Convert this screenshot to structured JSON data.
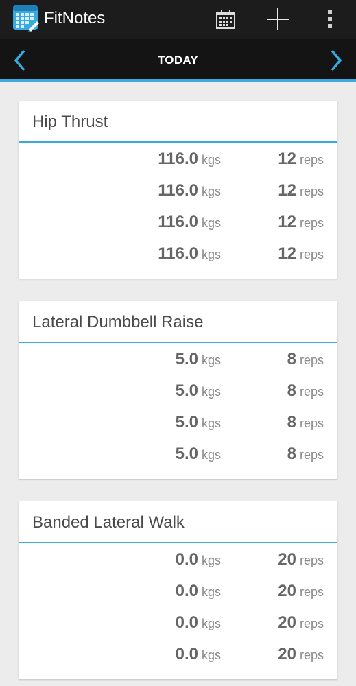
{
  "app": {
    "title": "FitNotes",
    "accent_color": "#3aa9e0",
    "icon": "fitnotes-app-icon"
  },
  "actions": {
    "calendar_icon": "calendar-icon",
    "add_icon": "plus-icon",
    "overflow_icon": "overflow-menu-icon"
  },
  "date_nav": {
    "label": "TODAY",
    "prev_icon": "chevron-left-icon",
    "next_icon": "chevron-right-icon"
  },
  "exercises": [
    {
      "name": "Hip Thrust",
      "sets": [
        {
          "weight": "116.0",
          "weight_unit": "kgs",
          "reps": "12",
          "reps_unit": "reps"
        },
        {
          "weight": "116.0",
          "weight_unit": "kgs",
          "reps": "12",
          "reps_unit": "reps"
        },
        {
          "weight": "116.0",
          "weight_unit": "kgs",
          "reps": "12",
          "reps_unit": "reps"
        },
        {
          "weight": "116.0",
          "weight_unit": "kgs",
          "reps": "12",
          "reps_unit": "reps"
        }
      ]
    },
    {
      "name": "Lateral Dumbbell Raise",
      "sets": [
        {
          "weight": "5.0",
          "weight_unit": "kgs",
          "reps": "8",
          "reps_unit": "reps"
        },
        {
          "weight": "5.0",
          "weight_unit": "kgs",
          "reps": "8",
          "reps_unit": "reps"
        },
        {
          "weight": "5.0",
          "weight_unit": "kgs",
          "reps": "8",
          "reps_unit": "reps"
        },
        {
          "weight": "5.0",
          "weight_unit": "kgs",
          "reps": "8",
          "reps_unit": "reps"
        }
      ]
    },
    {
      "name": "Banded Lateral Walk",
      "sets": [
        {
          "weight": "0.0",
          "weight_unit": "kgs",
          "reps": "20",
          "reps_unit": "reps"
        },
        {
          "weight": "0.0",
          "weight_unit": "kgs",
          "reps": "20",
          "reps_unit": "reps"
        },
        {
          "weight": "0.0",
          "weight_unit": "kgs",
          "reps": "20",
          "reps_unit": "reps"
        },
        {
          "weight": "0.0",
          "weight_unit": "kgs",
          "reps": "20",
          "reps_unit": "reps"
        }
      ]
    }
  ]
}
